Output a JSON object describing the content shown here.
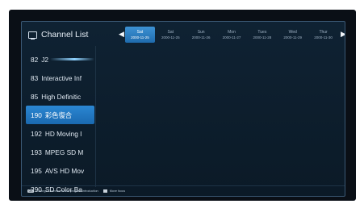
{
  "header": {
    "title": "Channel List"
  },
  "days": [
    {
      "name": "Sat",
      "date": "2000-11-25"
    },
    {
      "name": "Sat",
      "date": "2000-11-25"
    },
    {
      "name": "Sun",
      "date": "2000-11-26"
    },
    {
      "name": "Mon",
      "date": "2000-11-27"
    },
    {
      "name": "Tues",
      "date": "2000-11-28"
    },
    {
      "name": "Wed",
      "date": "2000-11-29"
    },
    {
      "name": "Thur",
      "date": "2000-11-30"
    }
  ],
  "channels": [
    {
      "number": "82",
      "name": "J2"
    },
    {
      "number": "83",
      "name": "Interactive Inf"
    },
    {
      "number": "85",
      "name": "High Definitic"
    },
    {
      "number": "190",
      "name": "彩色復合"
    },
    {
      "number": "192",
      "name": "HD Moving I"
    },
    {
      "number": "193",
      "name": "MPEG SD M"
    },
    {
      "number": "195",
      "name": "AVS HD Mov"
    },
    {
      "number": "290",
      "name": "SD Color Ba"
    }
  ],
  "footer": {
    "ok_key": "OK",
    "ok_text": "Change Channel / show program introduction",
    "move_text": "Move focus"
  },
  "colors": {
    "accent": "#2b87d3",
    "panel_border": "#3a5874"
  }
}
